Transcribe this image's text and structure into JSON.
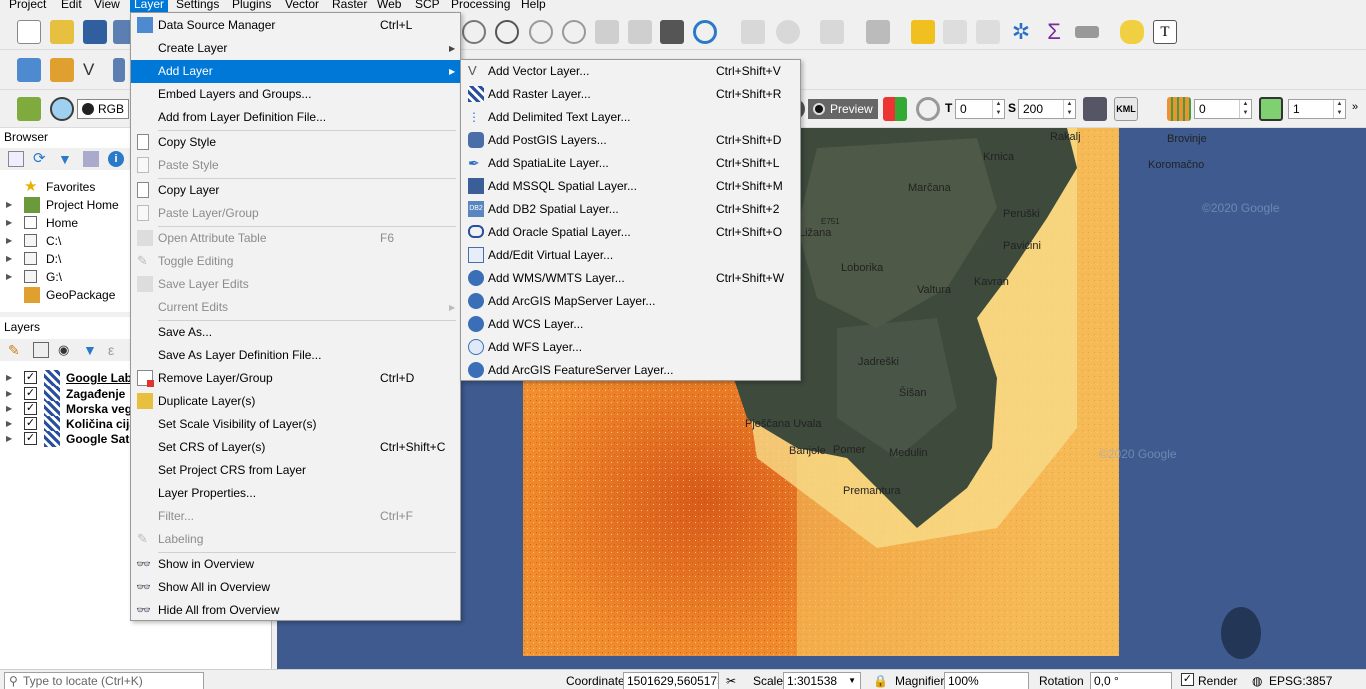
{
  "menubar": {
    "items": [
      "Project",
      "Edit",
      "View",
      "Layer",
      "Settings",
      "Plugins",
      "Vector",
      "Raster",
      "Web",
      "SCP",
      "Processing",
      "Help"
    ],
    "active": "Layer"
  },
  "toolbar3": {
    "rgb_label": "RGB =",
    "preview_label": "Preview",
    "t_value": "0",
    "s_value": "200",
    "kml_label": "KML",
    "val1": "0",
    "val2": "1"
  },
  "browser": {
    "title": "Browser",
    "items": [
      "Favorites",
      "Project Home",
      "Home",
      "C:\\",
      "D:\\",
      "G:\\",
      "GeoPackage"
    ]
  },
  "layers": {
    "title": "Layers",
    "items": [
      "Google Labe",
      "Zagađenje",
      "Morska veg",
      "Količina cija",
      "Google Sate"
    ]
  },
  "layer_menu": {
    "items": [
      {
        "label": "Data Source Manager",
        "shortcut": "Ctrl+L"
      },
      {
        "label": "Create Layer",
        "shortcut": ""
      },
      {
        "label": "Add Layer",
        "shortcut": ""
      },
      {
        "label": "Embed Layers and Groups...",
        "shortcut": ""
      },
      {
        "label": "Add from Layer Definition File...",
        "shortcut": ""
      },
      {
        "label": "Copy Style",
        "shortcut": ""
      },
      {
        "label": "Paste Style",
        "shortcut": ""
      },
      {
        "label": "Copy Layer",
        "shortcut": ""
      },
      {
        "label": "Paste Layer/Group",
        "shortcut": ""
      },
      {
        "label": "Open Attribute Table",
        "shortcut": "F6"
      },
      {
        "label": "Toggle Editing",
        "shortcut": ""
      },
      {
        "label": "Save Layer Edits",
        "shortcut": ""
      },
      {
        "label": "Current Edits",
        "shortcut": ""
      },
      {
        "label": "Save As...",
        "shortcut": ""
      },
      {
        "label": "Save As Layer Definition File...",
        "shortcut": ""
      },
      {
        "label": "Remove Layer/Group",
        "shortcut": "Ctrl+D"
      },
      {
        "label": "Duplicate Layer(s)",
        "shortcut": ""
      },
      {
        "label": "Set Scale Visibility of Layer(s)",
        "shortcut": ""
      },
      {
        "label": "Set CRS of Layer(s)",
        "shortcut": "Ctrl+Shift+C"
      },
      {
        "label": "Set Project CRS from Layer",
        "shortcut": ""
      },
      {
        "label": "Layer Properties...",
        "shortcut": ""
      },
      {
        "label": "Filter...",
        "shortcut": "Ctrl+F"
      },
      {
        "label": "Labeling",
        "shortcut": ""
      },
      {
        "label": "Show in Overview",
        "shortcut": ""
      },
      {
        "label": "Show All in Overview",
        "shortcut": ""
      },
      {
        "label": "Hide All from Overview",
        "shortcut": ""
      }
    ]
  },
  "add_layer_menu": {
    "items": [
      {
        "label": "Add Vector Layer...",
        "shortcut": "Ctrl+Shift+V"
      },
      {
        "label": "Add Raster Layer...",
        "shortcut": "Ctrl+Shift+R"
      },
      {
        "label": "Add Delimited Text Layer...",
        "shortcut": ""
      },
      {
        "label": "Add PostGIS Layers...",
        "shortcut": "Ctrl+Shift+D"
      },
      {
        "label": "Add SpatiaLite Layer...",
        "shortcut": "Ctrl+Shift+L"
      },
      {
        "label": "Add MSSQL Spatial Layer...",
        "shortcut": "Ctrl+Shift+M"
      },
      {
        "label": "Add DB2 Spatial Layer...",
        "shortcut": "Ctrl+Shift+2"
      },
      {
        "label": "Add Oracle Spatial Layer...",
        "shortcut": "Ctrl+Shift+O"
      },
      {
        "label": "Add/Edit Virtual Layer...",
        "shortcut": ""
      },
      {
        "label": "Add WMS/WMTS Layer...",
        "shortcut": "Ctrl+Shift+W"
      },
      {
        "label": "Add ArcGIS MapServer Layer...",
        "shortcut": ""
      },
      {
        "label": "Add WCS Layer...",
        "shortcut": ""
      },
      {
        "label": "Add WFS Layer...",
        "shortcut": ""
      },
      {
        "label": "Add ArcGIS FeatureServer Layer...",
        "shortcut": ""
      }
    ]
  },
  "map": {
    "place_labels": [
      "Rakalj",
      "Brovinje",
      "Krnica",
      "Koromačno",
      "Marčana",
      "E751",
      "Peruški",
      "Ližana",
      "Pavićini",
      "Loborika",
      "Kavran",
      "Valtura",
      "Jadreški",
      "Šišan",
      "Pješčana Uvala",
      "Banjole",
      "Pomer",
      "Medulin",
      "Premantura"
    ],
    "watermarks": [
      "©2020 Google",
      "©2020 Google"
    ]
  },
  "statusbar": {
    "locate_placeholder": "Type to locate (Ctrl+K)",
    "coordinate_label": "Coordinate",
    "coordinate_value": "1501629,5605175",
    "scale_label": "Scale",
    "scale_value": "1:301538",
    "magnifier_label": "Magnifier",
    "magnifier_value": "100%",
    "rotation_label": "Rotation",
    "rotation_value": "0,0 °",
    "render_label": "Render",
    "crs_label": "EPSG:3857"
  },
  "colors": {
    "accent": "#0078d7",
    "map_sea": "#3e5a8f",
    "raster_orange": "#f08a2c",
    "raster_light": "#f6c865"
  }
}
